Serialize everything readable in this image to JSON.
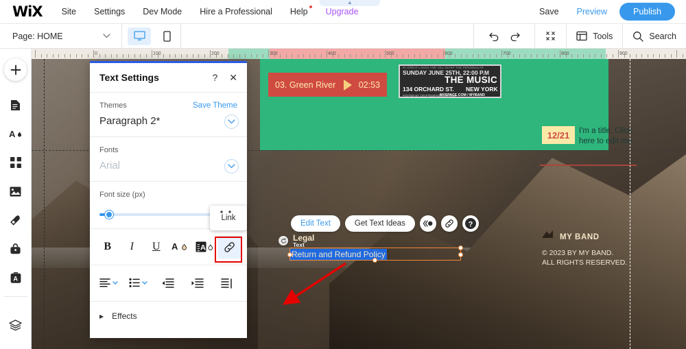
{
  "topbar": {
    "logo": "WiX",
    "nav": [
      {
        "label": "Site"
      },
      {
        "label": "Settings"
      },
      {
        "label": "Dev Mode"
      },
      {
        "label": "Hire a Professional"
      },
      {
        "label": "Help",
        "badge": true
      },
      {
        "label": "Upgrade",
        "accent": "#a855f7"
      }
    ],
    "save": "Save",
    "preview": "Preview",
    "publish": "Publish",
    "publish_color": "#3899ec"
  },
  "secondbar": {
    "page_label": "Page: HOME",
    "devices": [
      "desktop-icon",
      "mobile-icon"
    ],
    "undo": "undo-icon",
    "redo": "redo-icon",
    "zoom_out": "zoom-out-icon",
    "tools": "Tools",
    "search": "Search"
  },
  "sidebar": {
    "items": [
      {
        "name": "add-button",
        "icon": "plus-icon"
      },
      {
        "name": "pages-menu",
        "icon": "page-icon"
      },
      {
        "name": "site-design",
        "icon": "theme-icon"
      },
      {
        "name": "app-market",
        "icon": "apps-icon"
      },
      {
        "name": "my-uploads",
        "icon": "image-icon"
      },
      {
        "name": "blog",
        "icon": "pen-icon"
      },
      {
        "name": "business",
        "icon": "bag-icon"
      },
      {
        "name": "content-manager",
        "icon": "content-icon"
      },
      {
        "name": "layers",
        "icon": "layers-icon"
      }
    ]
  },
  "ruler": {
    "ticks": [
      0,
      100,
      200,
      300,
      400,
      500,
      600,
      700,
      800,
      900
    ],
    "unit": "px"
  },
  "panel": {
    "title": "Text Settings",
    "help_icon": "?",
    "close_icon": "✕",
    "themes_label": "Themes",
    "save_theme": "Save Theme",
    "theme_value": "Paragraph 2*",
    "fonts_label": "Fonts",
    "font_value": "Arial",
    "font_size_label": "Font size (px)",
    "format_buttons": [
      {
        "name": "bold-button",
        "glyph": "B",
        "selected": false
      },
      {
        "name": "italic-button",
        "glyph": "I",
        "selected": false
      },
      {
        "name": "underline-button",
        "glyph": "U",
        "selected": false
      },
      {
        "name": "text-color-button",
        "glyph": "A",
        "selected": false
      },
      {
        "name": "highlight-color-button",
        "glyph": "A",
        "selected": false
      },
      {
        "name": "link-button",
        "glyph": "link",
        "selected": true
      }
    ],
    "align_buttons": [
      {
        "name": "text-align-button",
        "icon": "align-left-icon"
      },
      {
        "name": "list-style-button",
        "icon": "bullet-list-icon"
      },
      {
        "name": "outdent-button",
        "icon": "outdent-icon"
      },
      {
        "name": "indent-button",
        "icon": "indent-icon"
      },
      {
        "name": "text-direction-button",
        "icon": "rtl-icon"
      }
    ],
    "effects_label": "Effects",
    "tooltip": "Link",
    "highlight_color": "#e60000",
    "accent": "#3899ec"
  },
  "canvas": {
    "music_player": {
      "track": "03. Green River",
      "duration": "02:53"
    },
    "poster": {
      "line1": "IN GREAT LAKES AND JILL GIANT THE PENINSULAR",
      "line2": "SUNDAY JUNE 25TH, 22:00 P.M",
      "line3": "THE MUSIC",
      "line4": "134 ORCHARD ST.",
      "line5": "NEW YORK",
      "line6": "POSTER BY CRAFTEDBYDESIGN.COM",
      "line7": "MYSPACE.COM / MYBAND"
    },
    "event": {
      "date": "12/21",
      "title": "I'm a title, Click here to edit me."
    },
    "footer": {
      "brand": "MY BAND",
      "copyright_line1": "© 2023 BY MY BAND.",
      "copyright_line2": "ALL RIGHTS RESERVED."
    },
    "legal": {
      "heading": "Legal",
      "element_badge": "Text",
      "selected_text": "Return and Refund Policy"
    },
    "edit_toolbar": {
      "edit_text": "Edit Text",
      "get_text_ideas": "Get Text Ideas",
      "animation_icon": "animation-icon",
      "link_icon": "link-icon",
      "help_icon": "help-icon"
    }
  }
}
